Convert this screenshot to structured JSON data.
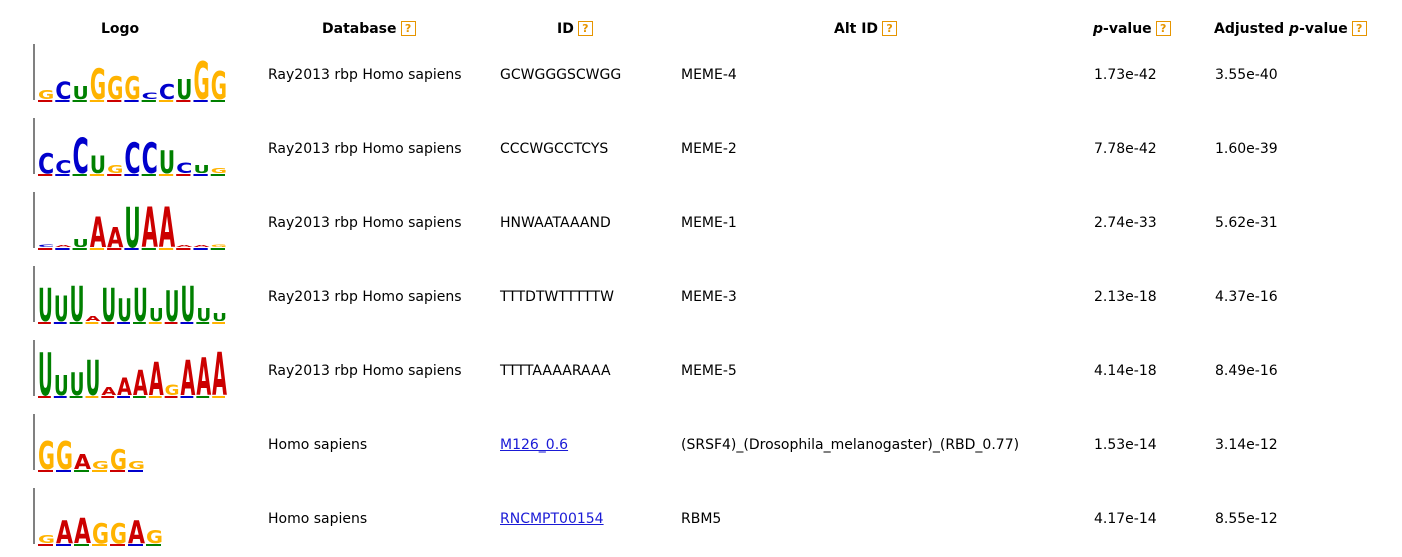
{
  "headers": {
    "logo": "Logo",
    "database": "Database",
    "id": "ID",
    "alt_id": "Alt ID",
    "pvalue_p": "p",
    "pvalue_rest": "-value",
    "adjusted_prefix": "Adjusted ",
    "adjusted_p": "p",
    "adjusted_rest": "-value",
    "help_glyph": "?"
  },
  "colors": {
    "A": "#cc0000",
    "C": "#0000cc",
    "G": "#ffb300",
    "U": "#008000",
    "link": "#1a1ad6",
    "help_border": "#e69500"
  },
  "rows": [
    {
      "database": "Ray2013 rbp Homo sapiens",
      "id": "GCWGGGSCWGG",
      "id_link": false,
      "alt_id": "MEME-4",
      "pvalue": "1.73e-42",
      "adjusted_pvalue": "3.55e-40",
      "logo_letters": "GCUGGGCCUGG",
      "logo_heights": [
        0.35,
        0.7,
        0.5,
        1.2,
        0.9,
        0.9,
        0.25,
        0.6,
        0.8,
        1.5,
        1.1
      ]
    },
    {
      "database": "Ray2013 rbp Homo sapiens",
      "id": "CCCWGCCTCYS",
      "id_link": false,
      "alt_id": "MEME-2",
      "pvalue": "7.78e-42",
      "adjusted_pvalue": "1.60e-39",
      "logo_letters": "CCCUGCCUCUG",
      "logo_heights": [
        0.8,
        0.5,
        1.4,
        0.7,
        0.3,
        1.2,
        1.2,
        0.9,
        0.4,
        0.3,
        0.2
      ]
    },
    {
      "database": "Ray2013 rbp Homo sapiens",
      "id": "HNWAATAAAND",
      "id_link": false,
      "alt_id": "MEME-1",
      "pvalue": "2.74e-33",
      "adjusted_pvalue": "5.62e-31",
      "logo_letters": "CAUAAUAAAAG",
      "logo_heights": [
        0.1,
        0.05,
        0.3,
        1.2,
        0.8,
        1.6,
        1.6,
        1.6,
        0.05,
        0.05,
        0.1
      ]
    },
    {
      "database": "Ray2013 rbp Homo sapiens",
      "id": "TTTDTWTTTTTW",
      "id_link": false,
      "alt_id": "MEME-3",
      "pvalue": "2.13e-18",
      "adjusted_pvalue": "4.37e-16",
      "logo_letters": "UUUAUUUUUUUU",
      "logo_heights": [
        1.3,
        1.0,
        1.4,
        0.2,
        1.3,
        0.9,
        1.3,
        0.5,
        1.2,
        1.4,
        0.5,
        0.3
      ]
    },
    {
      "database": "Ray2013 rbp Homo sapiens",
      "id": "TTTTAAAARAAA",
      "id_link": false,
      "alt_id": "MEME-5",
      "pvalue": "4.14e-18",
      "adjusted_pvalue": "8.49e-16",
      "logo_letters": "UUUUAAAAGAAA",
      "logo_heights": [
        1.7,
        0.8,
        0.9,
        1.4,
        0.3,
        0.7,
        1.0,
        1.3,
        0.4,
        1.4,
        1.5,
        1.7
      ]
    },
    {
      "database": "Homo sapiens",
      "id": "M126_0.6",
      "id_link": true,
      "alt_id": "(SRSF4)_(Drosophila_melanogaster)_(RBD_0.77)",
      "pvalue": "1.53e-14",
      "adjusted_pvalue": "3.14e-12",
      "logo_letters": "GGAGGG",
      "logo_heights": [
        1.1,
        1.1,
        0.6,
        0.3,
        0.8,
        0.3
      ]
    },
    {
      "database": "Homo sapiens",
      "id": "RNCMPT00154",
      "id_link": true,
      "alt_id": "RBM5",
      "pvalue": "4.17e-14",
      "adjusted_pvalue": "8.55e-12",
      "logo_letters": "GAAGGAG",
      "logo_heights": [
        0.3,
        0.9,
        1.0,
        0.8,
        0.8,
        0.9,
        0.5
      ]
    }
  ]
}
